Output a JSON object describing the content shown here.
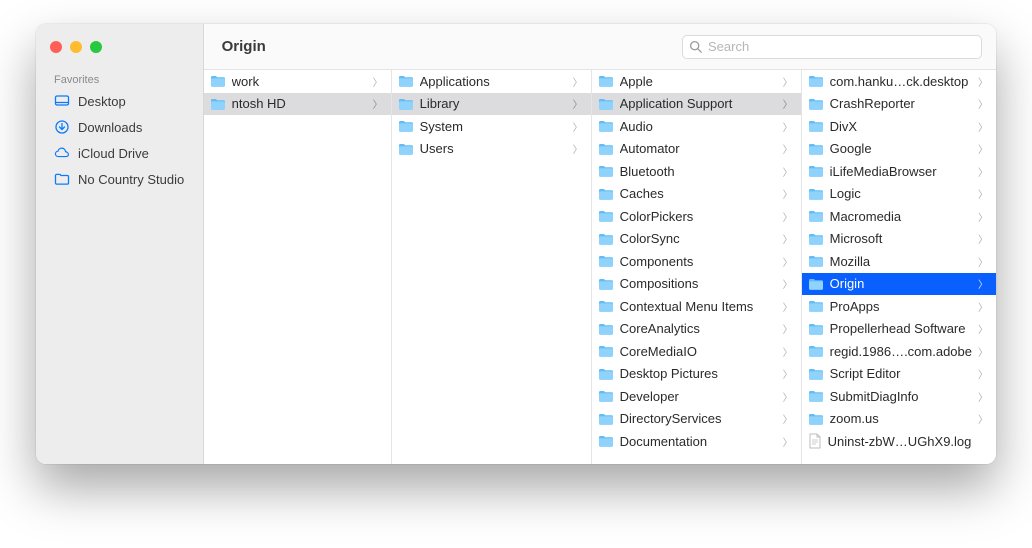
{
  "window_title": "Origin",
  "search_placeholder": "Search",
  "sidebar": {
    "section_label": "Favorites",
    "items": [
      {
        "icon": "desktop",
        "label": "Desktop"
      },
      {
        "icon": "download",
        "label": "Downloads"
      },
      {
        "icon": "cloud",
        "label": "iCloud Drive"
      },
      {
        "icon": "folder",
        "label": "No Country Studio"
      }
    ]
  },
  "columns": [
    {
      "items": [
        {
          "label": "work",
          "type": "folder",
          "truncated_prefix": true
        },
        {
          "label": "ntosh HD",
          "type": "folder",
          "path": true,
          "truncated_prefix": true
        }
      ]
    },
    {
      "items": [
        {
          "label": "Applications",
          "type": "folder"
        },
        {
          "label": "Library",
          "type": "folder",
          "path": true
        },
        {
          "label": "System",
          "type": "folder"
        },
        {
          "label": "Users",
          "type": "folder"
        }
      ]
    },
    {
      "items": [
        {
          "label": "Apple",
          "type": "folder"
        },
        {
          "label": "Application Support",
          "type": "folder",
          "path": true
        },
        {
          "label": "Audio",
          "type": "folder"
        },
        {
          "label": "Automator",
          "type": "folder"
        },
        {
          "label": "Bluetooth",
          "type": "folder"
        },
        {
          "label": "Caches",
          "type": "folder"
        },
        {
          "label": "ColorPickers",
          "type": "folder"
        },
        {
          "label": "ColorSync",
          "type": "folder"
        },
        {
          "label": "Components",
          "type": "folder"
        },
        {
          "label": "Compositions",
          "type": "folder"
        },
        {
          "label": "Contextual Menu Items",
          "type": "folder"
        },
        {
          "label": "CoreAnalytics",
          "type": "folder"
        },
        {
          "label": "CoreMediaIO",
          "type": "folder"
        },
        {
          "label": "Desktop Pictures",
          "type": "folder"
        },
        {
          "label": "Developer",
          "type": "folder"
        },
        {
          "label": "DirectoryServices",
          "type": "folder"
        },
        {
          "label": "Documentation",
          "type": "folder"
        }
      ]
    },
    {
      "items": [
        {
          "label": "com.hanku…ck.desktop",
          "type": "folder"
        },
        {
          "label": "CrashReporter",
          "type": "folder"
        },
        {
          "label": "DivX",
          "type": "folder"
        },
        {
          "label": "Google",
          "type": "folder"
        },
        {
          "label": "iLifeMediaBrowser",
          "type": "folder"
        },
        {
          "label": "Logic",
          "type": "folder"
        },
        {
          "label": "Macromedia",
          "type": "folder"
        },
        {
          "label": "Microsoft",
          "type": "folder"
        },
        {
          "label": "Mozilla",
          "type": "folder"
        },
        {
          "label": "Origin",
          "type": "folder",
          "selected": true
        },
        {
          "label": "ProApps",
          "type": "folder"
        },
        {
          "label": "Propellerhead Software",
          "type": "folder"
        },
        {
          "label": "regid.1986….com.adobe",
          "type": "folder"
        },
        {
          "label": "Script Editor",
          "type": "folder"
        },
        {
          "label": "SubmitDiagInfo",
          "type": "folder"
        },
        {
          "label": "zoom.us",
          "type": "folder"
        },
        {
          "label": "Uninst-zbW…UGhX9.log",
          "type": "file"
        }
      ]
    }
  ]
}
